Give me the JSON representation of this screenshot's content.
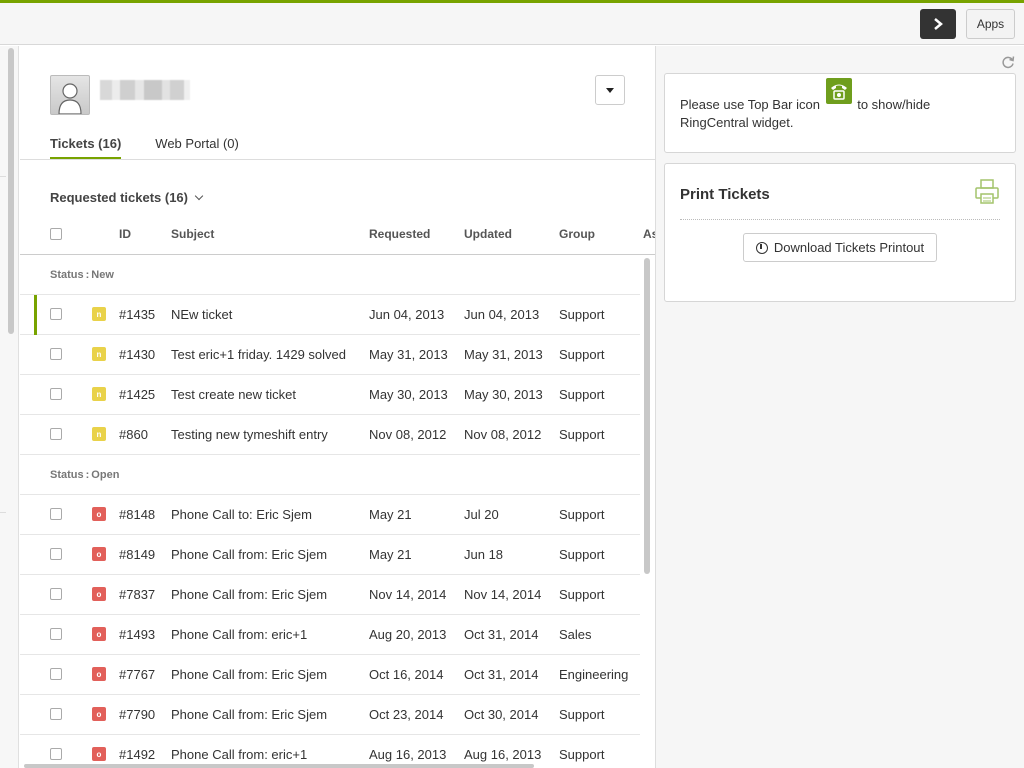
{
  "topbar": {
    "apps_label": "Apps",
    "accent": "#78a300"
  },
  "user": {
    "name_blurred": true
  },
  "tabs": [
    {
      "label": "Tickets (16)",
      "active": true
    },
    {
      "label": "Web Portal (0)",
      "active": false
    }
  ],
  "requested": {
    "title": "Requested tickets (16)"
  },
  "columns": {
    "id": "ID",
    "subject": "Subject",
    "requested": "Requested",
    "updated": "Updated",
    "group": "Group",
    "assignee": "As"
  },
  "groups": [
    {
      "status_prefix": "Status",
      "status_sep": ":",
      "status": "New",
      "badge_letter": "n",
      "tickets": [
        {
          "id": "#1435",
          "subject": "NEw ticket",
          "requested": "Jun 04, 2013",
          "updated": "Jun 04, 2013",
          "group": "Support",
          "selected": true
        },
        {
          "id": "#1430",
          "subject": "Test eric+1 friday. 1429 solved",
          "requested": "May 31, 2013",
          "updated": "May 31, 2013",
          "group": "Support"
        },
        {
          "id": "#1425",
          "subject": "Test create new ticket",
          "requested": "May 30, 2013",
          "updated": "May 30, 2013",
          "group": "Support"
        },
        {
          "id": "#860",
          "subject": "Testing new tymeshift entry",
          "requested": "Nov 08, 2012",
          "updated": "Nov 08, 2012",
          "group": "Support"
        }
      ]
    },
    {
      "status_prefix": "Status",
      "status_sep": ":",
      "status": "Open",
      "badge_letter": "o",
      "tickets": [
        {
          "id": "#8148",
          "subject": "Phone Call to: Eric Sjem",
          "requested": "May 21",
          "updated": "Jul 20",
          "group": "Support"
        },
        {
          "id": "#8149",
          "subject": "Phone Call from: Eric Sjem",
          "requested": "May 21",
          "updated": "Jun 18",
          "group": "Support"
        },
        {
          "id": "#7837",
          "subject": "Phone Call from: Eric Sjem",
          "requested": "Nov 14, 2014",
          "updated": "Nov 14, 2014",
          "group": "Support"
        },
        {
          "id": "#1493",
          "subject": "Phone Call from: eric+1",
          "requested": "Aug 20, 2013",
          "updated": "Oct 31, 2014",
          "group": "Sales"
        },
        {
          "id": "#7767",
          "subject": "Phone Call from: Eric Sjem",
          "requested": "Oct 16, 2014",
          "updated": "Oct 31, 2014",
          "group": "Engineering"
        },
        {
          "id": "#7790",
          "subject": "Phone Call from: Eric Sjem",
          "requested": "Oct 23, 2014",
          "updated": "Oct 30, 2014",
          "group": "Support"
        },
        {
          "id": "#1492",
          "subject": "Phone Call from: eric+1",
          "requested": "Aug 16, 2013",
          "updated": "Aug 16, 2013",
          "group": "Support"
        }
      ]
    }
  ],
  "ringcentral": {
    "before_icon": "Please use Top Bar icon",
    "after_icon": "to show/hide",
    "line2": "RingCentral widget.",
    "icon": "phone-icon"
  },
  "print": {
    "title": "Print Tickets",
    "button_label": "Download Tickets Printout"
  },
  "colors": {
    "new_badge": "#e9d24a",
    "open_badge": "#e2605a",
    "accent": "#78a300"
  }
}
